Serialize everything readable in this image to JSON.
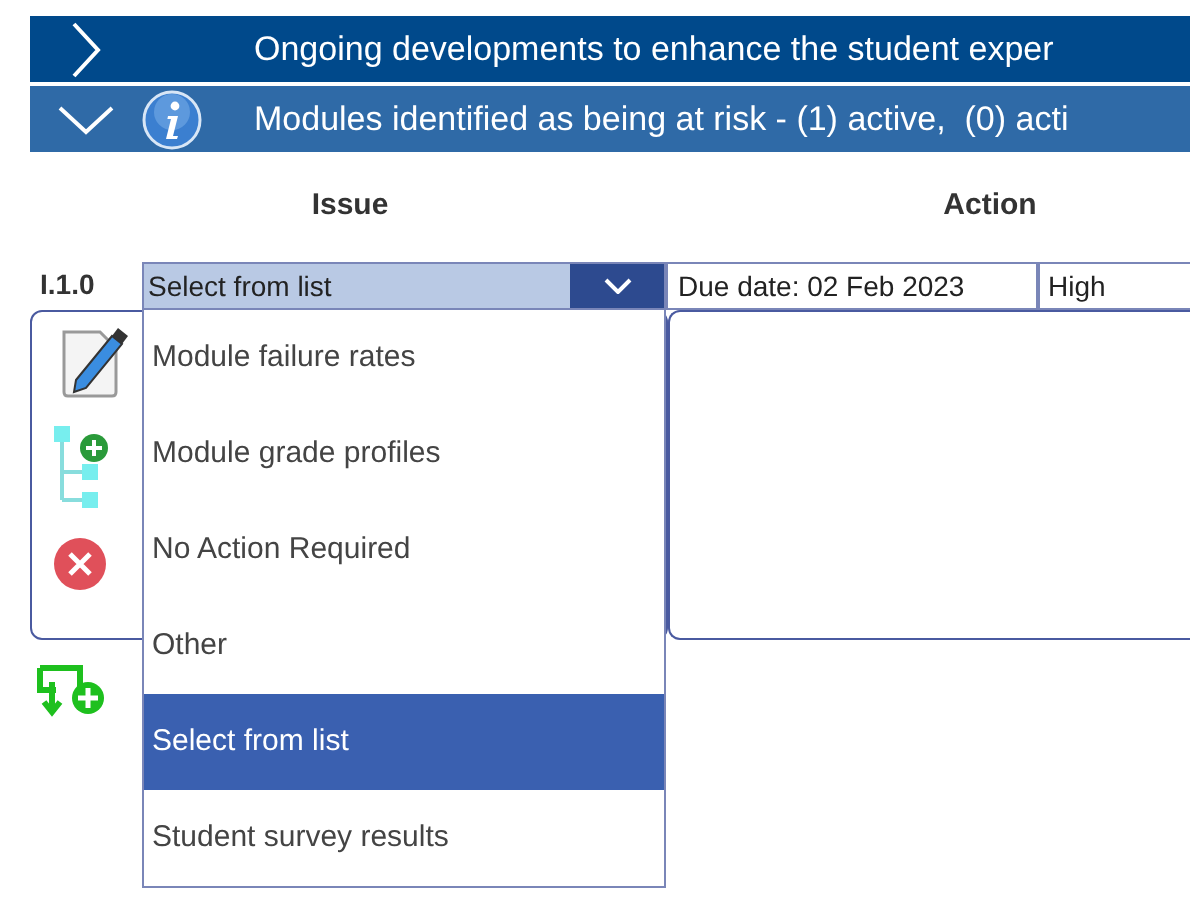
{
  "sections": [
    {
      "title": "Ongoing developments to enhance the student exper",
      "expanded": false,
      "info": false
    },
    {
      "title": "Modules identified as being at risk - (1) active,  (0) acti",
      "expanded": true,
      "info": true
    }
  ],
  "columns": [
    "Issue",
    "Action"
  ],
  "row": {
    "label": "I.1.0",
    "issue": {
      "value": "Select from list",
      "open": true
    },
    "due_date": "Due date: 02 Feb 2023",
    "priority": "High"
  },
  "options": [
    {
      "label": "Module failure rates",
      "selected": false
    },
    {
      "label": "Module grade profiles",
      "selected": false
    },
    {
      "label": "No Action Required",
      "selected": false
    },
    {
      "label": "Other",
      "selected": false
    },
    {
      "label": "Select from list",
      "selected": true
    },
    {
      "label": "Student survey results",
      "selected": false
    }
  ]
}
